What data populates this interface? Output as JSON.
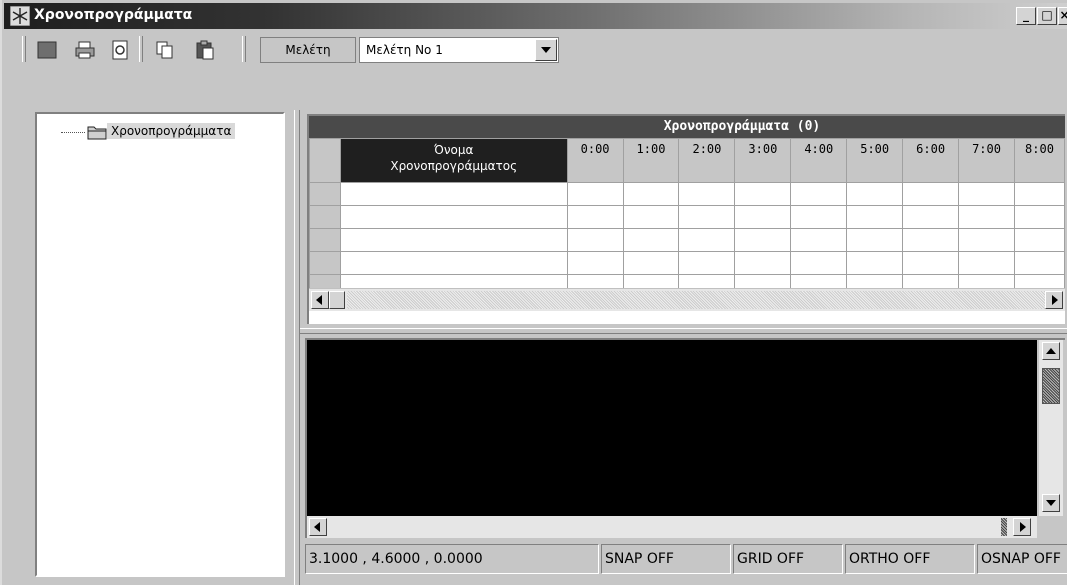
{
  "window": {
    "title": "Χρονοπρογράμματα",
    "minimize_glyph": "_",
    "maximize_glyph": "□",
    "close_glyph": "×"
  },
  "toolbar": {
    "study_label": "Μελέτη",
    "study_value": "Μελέτη Νο 1",
    "icons": [
      "save-icon",
      "print-icon",
      "preview-icon",
      "copy-icon",
      "paste-icon"
    ]
  },
  "tree": {
    "root_label": "Χρονοπρογράμματα"
  },
  "grid": {
    "title": "Χρονοπρογράμματα (0)",
    "name_header_line1": "Όνομα",
    "name_header_line2": "Χρονοπρογράμματος",
    "hour_headers": [
      "0:00",
      "1:00",
      "2:00",
      "3:00",
      "4:00",
      "5:00",
      "6:00",
      "7:00",
      "8:00"
    ],
    "row_count": 5
  },
  "status": {
    "coords": "3.1000 , 4.6000 , 0.0000",
    "snap": "SNAP OFF",
    "grid": "GRID OFF",
    "ortho": "ORTHO OFF",
    "osnap": "OSNAP OFF"
  },
  "colors": {
    "title_gradient_start": "#1e1e1e",
    "canvas": "#000000",
    "grid_title_bg": "#4a4a4a",
    "face": "#c6c6c6"
  }
}
